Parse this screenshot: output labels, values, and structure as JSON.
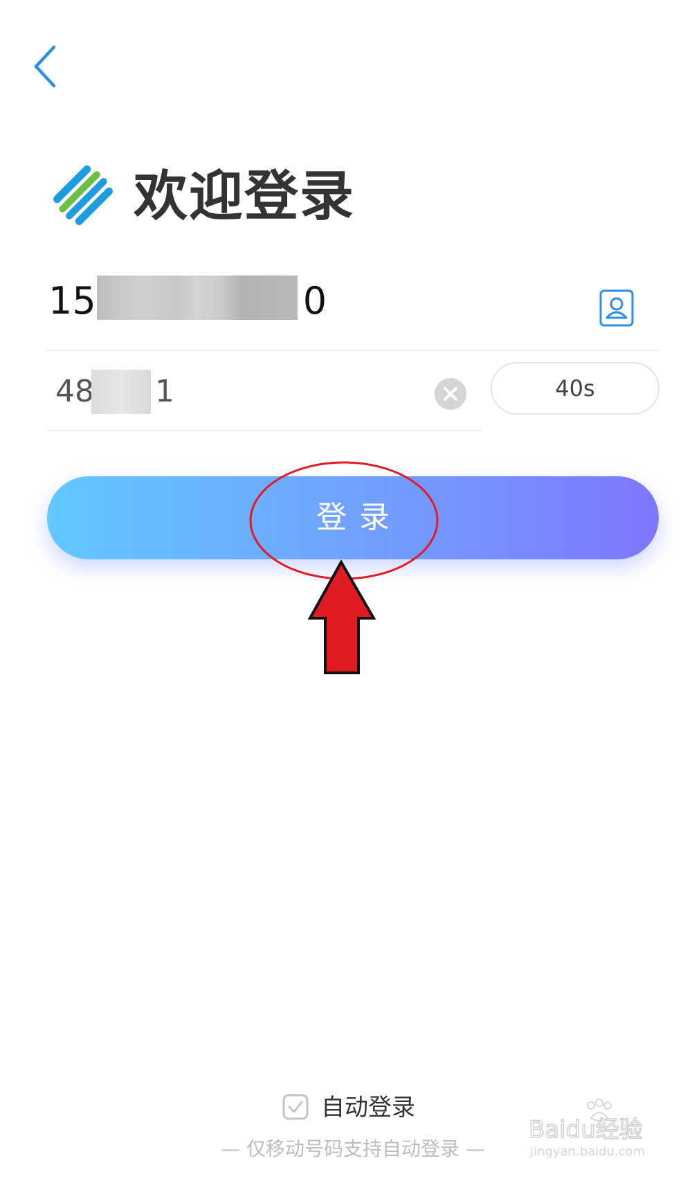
{
  "header": {
    "welcome_title": "欢迎登录"
  },
  "phone": {
    "prefix": "15",
    "suffix": "0"
  },
  "code": {
    "prefix": "48",
    "suffix": "1",
    "countdown_label": "40s"
  },
  "login": {
    "label": "登录"
  },
  "auto_login": {
    "label": "自动登录",
    "checked": true,
    "hint": "— 仅移动号码支持自动登录 —"
  },
  "watermark": {
    "text": "Baidu经验",
    "subtext": "jingyan.baidu.com"
  },
  "colors": {
    "accent_blue": "#2a8fe0",
    "button_gradient_start": "#62c8fe",
    "button_gradient_end": "#7f76fe",
    "annotation_red": "#e01b24"
  },
  "icons": {
    "back": "chevron-left-icon",
    "logo": "china-mobile-logo",
    "contacts": "contacts-icon",
    "clear": "close-circle-icon",
    "checkbox": "check-icon"
  }
}
